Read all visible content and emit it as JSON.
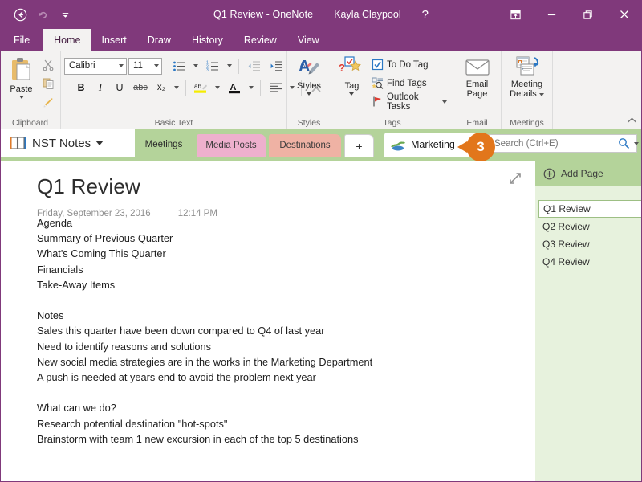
{
  "titlebar": {
    "back_icon": "back-arrow-icon",
    "undo_icon": "undo-icon",
    "qat_more_icon": "qat-dropdown-icon",
    "title": "Q1 Review - OneNote",
    "user": "Kayla Claypool",
    "help": "?",
    "ribbon_display_icon": "ribbon-display-options-icon",
    "minimize_icon": "minimize-icon",
    "restore_icon": "restore-icon",
    "close_icon": "close-icon"
  },
  "ribbon_tabs": [
    {
      "label": "File",
      "active": false
    },
    {
      "label": "Home",
      "active": true
    },
    {
      "label": "Insert",
      "active": false
    },
    {
      "label": "Draw",
      "active": false
    },
    {
      "label": "History",
      "active": false
    },
    {
      "label": "Review",
      "active": false
    },
    {
      "label": "View",
      "active": false
    }
  ],
  "ribbon": {
    "clipboard": {
      "group_label": "Clipboard",
      "paste_label": "Paste",
      "cut_icon": "scissors-icon",
      "copy_icon": "copy-icon",
      "format_painter_icon": "format-painter-icon"
    },
    "basic_text": {
      "group_label": "Basic Text",
      "font_name": "Calibri",
      "font_size": "11",
      "bold": "B",
      "italic": "I",
      "underline": "U",
      "strikethrough": "abc",
      "subscript": "x₂",
      "bullets_icon": "bulleted-list-icon",
      "numbering_icon": "numbered-list-icon",
      "decrease_indent_icon": "decrease-indent-icon",
      "increase_indent_icon": "increase-indent-icon",
      "clear_formatting_icon": "clear-formatting-icon",
      "highlight_icon": "text-highlight-icon",
      "font_color_icon": "font-color-icon",
      "align_icon": "align-left-icon",
      "remove_icon": "delete-x-icon"
    },
    "styles": {
      "group_label": "Styles",
      "button_label": "Styles",
      "icon": "styles-icon"
    },
    "tags": {
      "group_label": "Tags",
      "tag_button_label": "Tag",
      "tag_icon": "tag-star-icon",
      "items": [
        {
          "label": "To Do Tag",
          "icon": "checkbox-icon"
        },
        {
          "label": "Find Tags",
          "icon": "find-tags-icon"
        },
        {
          "label": "Outlook Tasks",
          "icon": "outlook-flag-icon",
          "has_caret": true
        }
      ]
    },
    "email": {
      "group_label": "Email",
      "button_label_line1": "Email",
      "button_label_line2": "Page",
      "icon": "envelope-icon"
    },
    "meetings": {
      "group_label": "Meetings",
      "button_label_line1": "Meeting",
      "button_label_line2": "Details",
      "icon": "meeting-details-icon"
    },
    "collapse_icon": "collapse-ribbon-icon"
  },
  "navbar": {
    "notebook_name": "NST Notes",
    "notebook_icon": "notebook-icon",
    "notebook_caret_icon": "chevron-down-icon",
    "sections": [
      {
        "label": "Meetings",
        "color": "#b4d39a",
        "active": true
      },
      {
        "label": "Media Posts",
        "color": "#eeb0cd",
        "active": false
      },
      {
        "label": "Destinations",
        "color": "#efb2a4",
        "active": false
      }
    ],
    "add_section_label": "+",
    "new_section": {
      "icon": "new-section-icon",
      "value": "Marketing"
    },
    "search": {
      "placeholder": "Search (Ctrl+E)",
      "value": "",
      "search_icon": "search-icon",
      "caret_icon": "chevron-down-icon"
    }
  },
  "page": {
    "expand_icon": "expand-page-icon",
    "title": "Q1 Review",
    "date": "Friday, September 23, 2016",
    "time": "12:14 PM",
    "body": "Agenda\nSummary of Previous Quarter\nWhat's Coming This Quarter\nFinancials\nTake-Away Items\n\nNotes\nSales this quarter have been down compared to Q4 of last year\nNeed to identify reasons and solutions\nNew social media strategies are in the works in the Marketing Department\nA push is needed at years end to avoid the problem next year\n\nWhat can we do?\nResearch potential destination \"hot-spots\"\nBrainstorm with team 1 new excursion in each of the top 5 destinations"
  },
  "pagelist": {
    "add_page_label": "Add Page",
    "add_page_icon": "add-circle-icon",
    "pages": [
      {
        "label": "Q1 Review",
        "selected": true
      },
      {
        "label": "Q2 Review",
        "selected": false
      },
      {
        "label": "Q3 Review",
        "selected": false
      },
      {
        "label": "Q4 Review",
        "selected": false
      }
    ]
  },
  "callout": {
    "number": "3",
    "color": "#e2761b"
  },
  "theme": {
    "accent": "#80397B",
    "section_green": "#b4d39a",
    "pagelist_bg": "#e7f2dd",
    "ribbon_bg": "#f3f2f1"
  }
}
